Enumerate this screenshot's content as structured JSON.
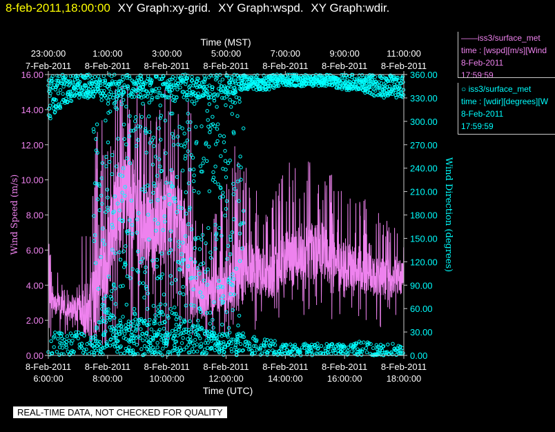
{
  "header": {
    "timestamp": "8-feb-2011,18:00:00",
    "graph_names": [
      "XY Graph:xy-grid.",
      "XY Graph:wspd.",
      "XY Graph:wdir."
    ]
  },
  "legend": {
    "wspd": {
      "marker": "——",
      "name": "iss3/surface_met",
      "line2": "time : [wspd][m/s][Wind",
      "date": "8-Feb-2011",
      "time": "17:59:59"
    },
    "wdir": {
      "marker": "○",
      "name": "iss3/surface_met",
      "line2": "time : [wdir][degrees][W",
      "date": "8-Feb-2011",
      "time": "17:59:59"
    }
  },
  "disclaimer": "REAL-TIME DATA, NOT CHECKED FOR QUALITY",
  "colors": {
    "wspd": "#ee82ee",
    "wdir": "#00ffff",
    "timestamp": "#ffff00",
    "background": "#000000"
  },
  "chart_data": {
    "type": "line",
    "x_top_label": "Time (MST)",
    "x_top_ticks": [
      [
        "23:00:00",
        "7-Feb-2011"
      ],
      [
        "1:00:00",
        "8-Feb-2011"
      ],
      [
        "3:00:00",
        "8-Feb-2011"
      ],
      [
        "5:00:00",
        "8-Feb-2011"
      ],
      [
        "7:00:00",
        "8-Feb-2011"
      ],
      [
        "9:00:00",
        "8-Feb-2011"
      ],
      [
        "11:00:00",
        "8-Feb-2011"
      ]
    ],
    "x_bottom_label": "Time (UTC)",
    "x_bottom_ticks": [
      [
        "8-Feb-2011",
        "6:00:00"
      ],
      [
        "8-Feb-2011",
        "8:00:00"
      ],
      [
        "8-Feb-2011",
        "10:00:00"
      ],
      [
        "8-Feb-2011",
        "12:00:00"
      ],
      [
        "8-Feb-2011",
        "14:00:00"
      ],
      [
        "8-Feb-2011",
        "16:00:00"
      ],
      [
        "8-Feb-2011",
        "18:00:00"
      ]
    ],
    "x_range_utc_hours": [
      6,
      18
    ],
    "ylabel_left": "Wind Speed (m/s)",
    "ylim_left": [
      0,
      16
    ],
    "yticks_left": [
      "0.00",
      "2.00",
      "4.00",
      "6.00",
      "8.00",
      "10.00",
      "12.00",
      "14.00",
      "16.00"
    ],
    "ylabel_right": "Wind Direction (degrees)",
    "ylim_right": [
      0,
      360
    ],
    "yticks_right": [
      "0.00",
      "30.00",
      "60.00",
      "90.00",
      "120.00",
      "150.00",
      "180.00",
      "210.00",
      "240.00",
      "270.00",
      "300.00",
      "330.00",
      "360.00"
    ],
    "series": [
      {
        "name": "iss3/surface_met wspd",
        "axis": "left",
        "style": "line",
        "x_utc_hours": [
          6.0,
          6.25,
          6.5,
          6.75,
          7.0,
          7.25,
          7.5,
          7.75,
          8.0,
          8.25,
          8.5,
          8.75,
          9.0,
          9.25,
          9.5,
          9.75,
          10.0,
          10.25,
          10.5,
          10.75,
          11.0,
          11.25,
          11.5,
          11.75,
          12.0,
          12.25,
          12.5,
          12.75,
          13.0,
          13.25,
          13.5,
          13.75,
          14.0,
          14.25,
          14.5,
          14.75,
          15.0,
          15.25,
          15.5,
          15.75,
          16.0,
          16.25,
          16.5,
          16.75,
          17.0,
          17.25,
          17.5,
          17.75,
          18.0
        ],
        "median": [
          4.0,
          3.0,
          2.8,
          2.6,
          2.6,
          2.4,
          2.6,
          4.0,
          6.0,
          8.0,
          9.0,
          9.0,
          8.0,
          7.0,
          7.0,
          7.5,
          8.0,
          8.0,
          7.0,
          5.0,
          3.8,
          3.6,
          3.6,
          3.8,
          4.0,
          4.5,
          4.5,
          5.0,
          5.0,
          4.5,
          4.5,
          5.0,
          5.5,
          5.5,
          6.0,
          6.0,
          6.0,
          6.0,
          5.5,
          5.5,
          5.0,
          5.0,
          5.0,
          4.8,
          4.5,
          4.5,
          4.5,
          4.5,
          4.5
        ],
        "max": [
          6.5,
          5.0,
          4.0,
          3.5,
          5.0,
          9.0,
          14.0,
          15.0,
          15.0,
          15.5,
          15.5,
          15.5,
          15.5,
          15.5,
          14.5,
          15.0,
          15.5,
          15.5,
          15.0,
          15.0,
          12.0,
          9.0,
          8.5,
          9.0,
          11.0,
          12.5,
          13.5,
          10.0,
          9.5,
          8.5,
          9.0,
          10.0,
          11.0,
          11.0,
          11.5,
          11.0,
          12.0,
          11.0,
          10.5,
          10.5,
          9.5,
          9.5,
          9.0,
          9.0,
          8.0,
          8.5,
          7.5,
          7.5,
          8.0
        ],
        "min": [
          1.0,
          1.0,
          0.8,
          0.8,
          1.0,
          1.0,
          0.5,
          0.5,
          0.3,
          0.3,
          0.5,
          0.3,
          0.5,
          0.5,
          0.3,
          0.3,
          0.3,
          0.3,
          0.5,
          0.5,
          0.5,
          1.0,
          1.0,
          1.0,
          1.0,
          1.2,
          1.0,
          1.0,
          1.0,
          1.2,
          1.5,
          1.5,
          2.0,
          2.0,
          2.0,
          2.0,
          2.5,
          2.0,
          2.0,
          2.0,
          1.5,
          1.5,
          2.0,
          2.0,
          1.5,
          1.5,
          1.8,
          1.8,
          2.0
        ]
      },
      {
        "name": "iss3/surface_met wdir",
        "axis": "right",
        "style": "markers",
        "x_utc_hours": [
          6.0,
          6.5,
          7.0,
          7.5,
          8.0,
          8.5,
          9.0,
          9.5,
          10.0,
          10.5,
          11.0,
          11.5,
          12.0,
          12.5,
          13.0,
          13.5,
          14.0,
          14.5,
          15.0,
          15.5,
          16.0,
          16.5,
          17.0,
          17.5,
          18.0
        ],
        "north_cluster_low": [
          300,
          320,
          330,
          330,
          330,
          330,
          330,
          330,
          330,
          330,
          330,
          330,
          330,
          340,
          340,
          340,
          345,
          345,
          345,
          345,
          340,
          340,
          330,
          330,
          330
        ],
        "south_cluster_high": [
          40,
          30,
          30,
          30,
          60,
          40,
          50,
          50,
          60,
          50,
          40,
          30,
          30,
          30,
          25,
          20,
          15,
          15,
          15,
          15,
          15,
          20,
          15,
          15,
          15
        ]
      }
    ],
    "grid": false,
    "legend_position": "right"
  }
}
